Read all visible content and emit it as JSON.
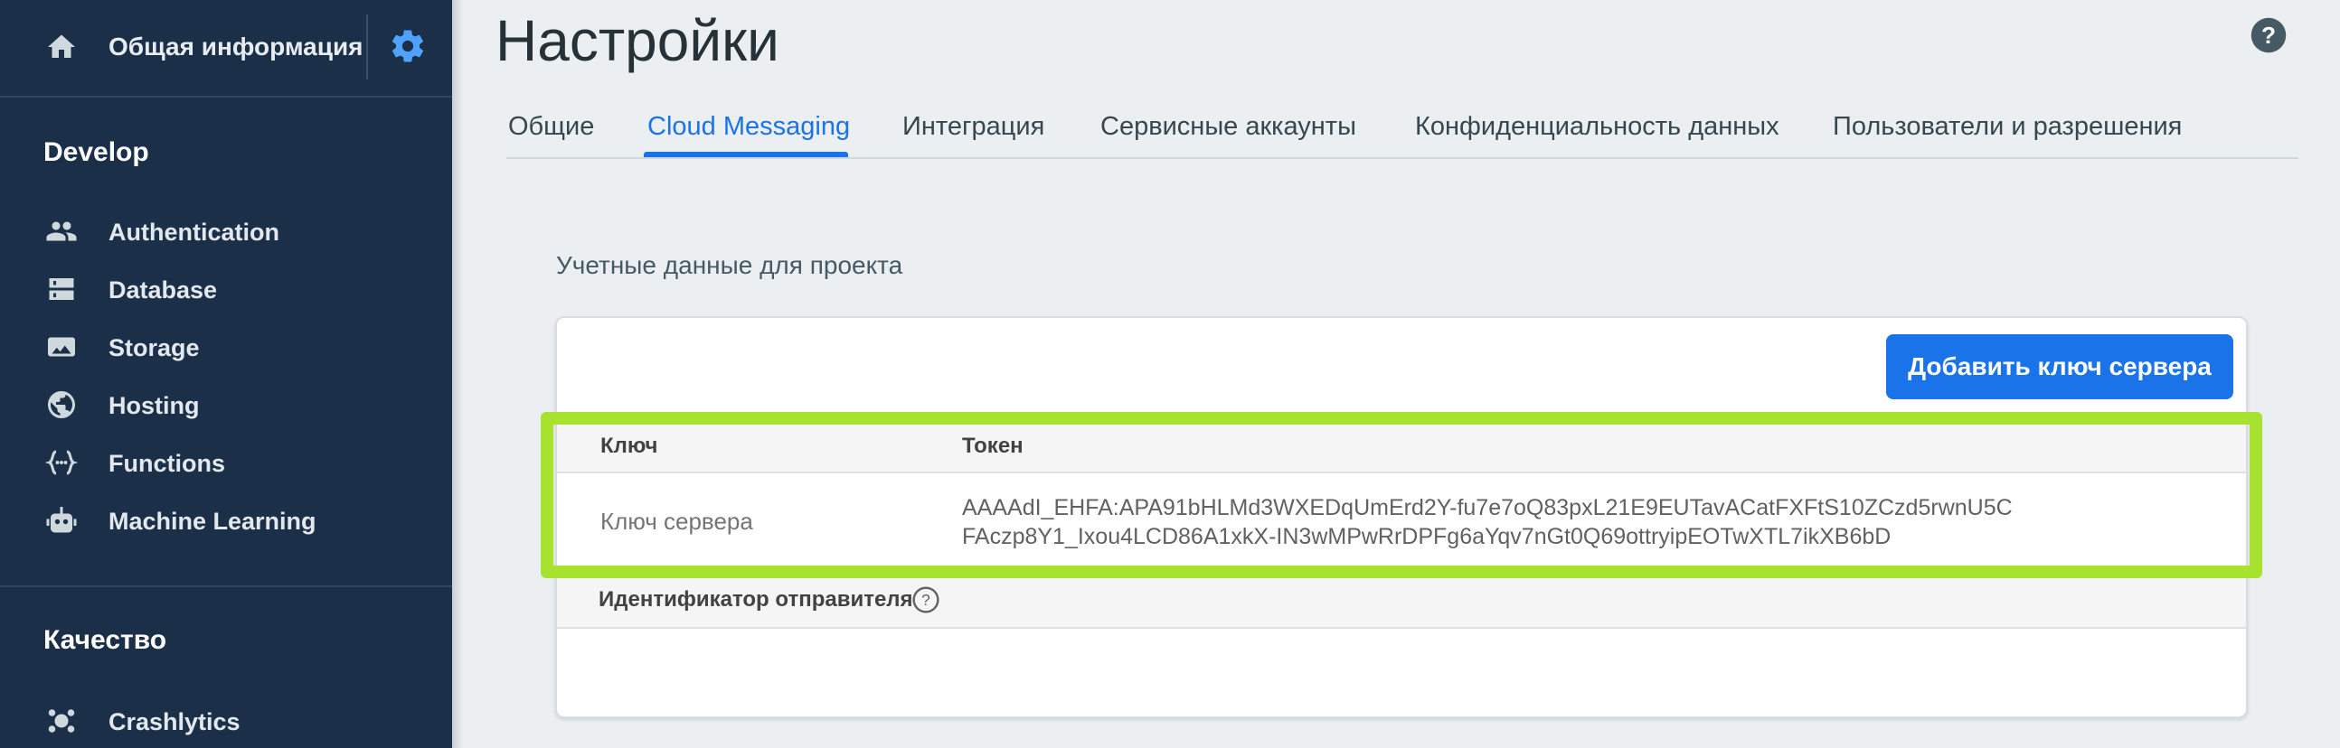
{
  "sidebar": {
    "project_name": "Общая информация о проекте",
    "sections": [
      {
        "title": "Develop",
        "items": [
          {
            "label": "Authentication",
            "icon": "people-icon"
          },
          {
            "label": "Database",
            "icon": "database-icon"
          },
          {
            "label": "Storage",
            "icon": "image-icon"
          },
          {
            "label": "Hosting",
            "icon": "globe-icon"
          },
          {
            "label": "Functions",
            "icon": "functions-icon"
          },
          {
            "label": "Machine Learning",
            "icon": "robot-icon"
          }
        ]
      },
      {
        "title": "Качество",
        "items": [
          {
            "label": "Crashlytics",
            "icon": "crashlytics-icon"
          }
        ]
      }
    ]
  },
  "header": {
    "title": "Настройки"
  },
  "tabs": [
    {
      "label": "Общие",
      "active": false
    },
    {
      "label": "Cloud Messaging",
      "active": true
    },
    {
      "label": "Интеграция",
      "active": false
    },
    {
      "label": "Сервисные аккаунты",
      "active": false
    },
    {
      "label": "Конфиденциальность данных",
      "active": false
    },
    {
      "label": "Пользователи и разрешения",
      "active": false
    }
  ],
  "credentials": {
    "heading": "Учетные данные для проекта",
    "add_key_label": "Добавить ключ сервера",
    "columns": {
      "key": "Ключ",
      "token": "Токен"
    },
    "row": {
      "key": "Ключ сервера",
      "token_line1": "AAAAdI_EHFA:APA91bHLMd3WXEDqUmErd2Y-fu7e7oQ83pxL21E9EUTavACatFXFtS10ZCzd5rwnU5C",
      "token_line2": "FAczp8Y1_Ixou4LCD86A1xkX-IN3wMPwRrDPFg6aYqv7nGt0Q69ottryipEOTwXTL7ikXB6bD"
    },
    "sender_label": "Идентификатор отправителя"
  },
  "colors": {
    "sidebar_bg": "#1b3048",
    "accent": "#1a73e8",
    "highlight": "#a6e22e"
  }
}
